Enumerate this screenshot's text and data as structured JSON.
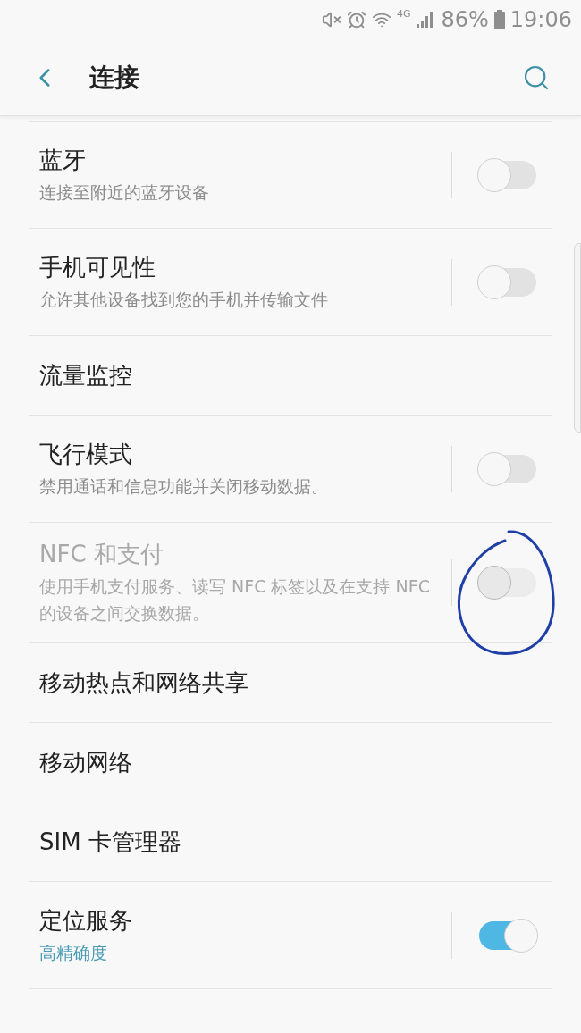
{
  "status_bar": {
    "network": "4G",
    "battery": "86%",
    "time": "19:06"
  },
  "header": {
    "title": "连接"
  },
  "items": [
    {
      "kind": "toggle",
      "title": "蓝牙",
      "subtitle": "连接至附近的蓝牙设备",
      "on": false,
      "disabled": false
    },
    {
      "kind": "toggle",
      "title": "手机可见性",
      "subtitle": "允许其他设备找到您的手机并传输文件",
      "on": false,
      "disabled": false
    },
    {
      "kind": "link",
      "title": "流量监控"
    },
    {
      "kind": "toggle",
      "title": "飞行模式",
      "subtitle": "禁用通话和信息功能并关闭移动数据。",
      "on": false,
      "disabled": false
    },
    {
      "kind": "toggle",
      "title": "NFC 和支付",
      "subtitle": "使用手机支付服务、读写 NFC 标签以及在支持 NFC 的设备之间交换数据。",
      "on": false,
      "disabled": true,
      "annotated": true
    },
    {
      "kind": "link",
      "title": "移动热点和网络共享"
    },
    {
      "kind": "link",
      "title": "移动网络"
    },
    {
      "kind": "link",
      "title": "SIM 卡管理器"
    },
    {
      "kind": "toggle",
      "title": "定位服务",
      "subtitle": "高精确度",
      "subtitle_accent": true,
      "on": true,
      "disabled": false
    }
  ]
}
